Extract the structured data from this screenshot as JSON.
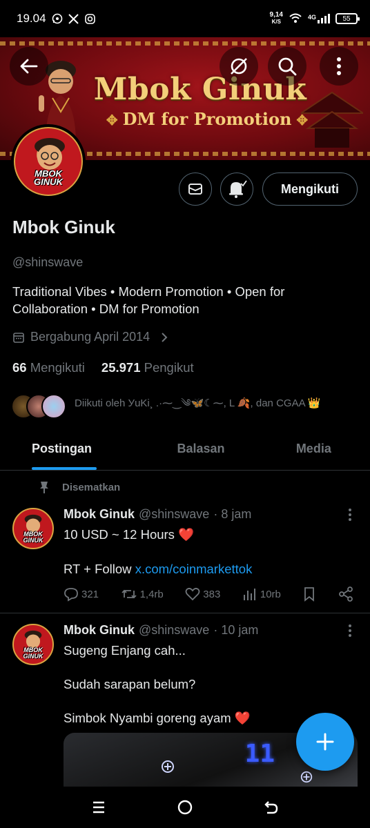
{
  "status_bar": {
    "time": "19.04",
    "net_speed": "9,14",
    "net_unit": "K/S",
    "network": "4G",
    "battery": "55"
  },
  "banner": {
    "title": "Mbok Ginuk",
    "subtitle": "DM for Promotion"
  },
  "avatar_label": {
    "line1": "MBOK",
    "line2": "GINUK"
  },
  "profile": {
    "follow_button": "Mengikuti",
    "name": "Mbok Ginuk",
    "handle": "@shinswave",
    "bio": "Traditional Vibes • Modern Promotion • Open for Collaboration • DM for Promotion",
    "joined": "Bergabung April 2014",
    "following_count": "66",
    "following_label": "Mengikuti",
    "followers_count": "25.971",
    "followers_label": "Pengikut",
    "followed_by": "Diikuti oleh УuKi¸ .·⁓‿༄🦋☾⁓, L 🍂, dan CGAA 👑"
  },
  "tabs": [
    "Postingan",
    "Balasan",
    "Media"
  ],
  "pinned_label": "Disematkan",
  "posts": [
    {
      "name": "Mbok Ginuk",
      "handle": "@shinswave",
      "time": "· 8 jam",
      "line1": "10 USD ~ 12 Hours",
      "line2_prefix": "RT + Follow ",
      "link": "x.com/coinmarkettok",
      "replies": "321",
      "reposts": "1,4rb",
      "likes": "383",
      "views": "10rb"
    },
    {
      "name": "Mbok Ginuk",
      "handle": "@shinswave",
      "time": "· 10 jam",
      "line1": "Sugeng Enjang cah...",
      "line2": "Sudah sarapan belum?",
      "line3": "Simbok Nyambi goreng ayam"
    }
  ],
  "media_digits": "11",
  "colors": {
    "accent": "#1d9bf0",
    "heart": "#f4212e",
    "muted": "#71767b",
    "banner_red": "#8a0f14",
    "banner_gold": "#f3cf7a"
  }
}
